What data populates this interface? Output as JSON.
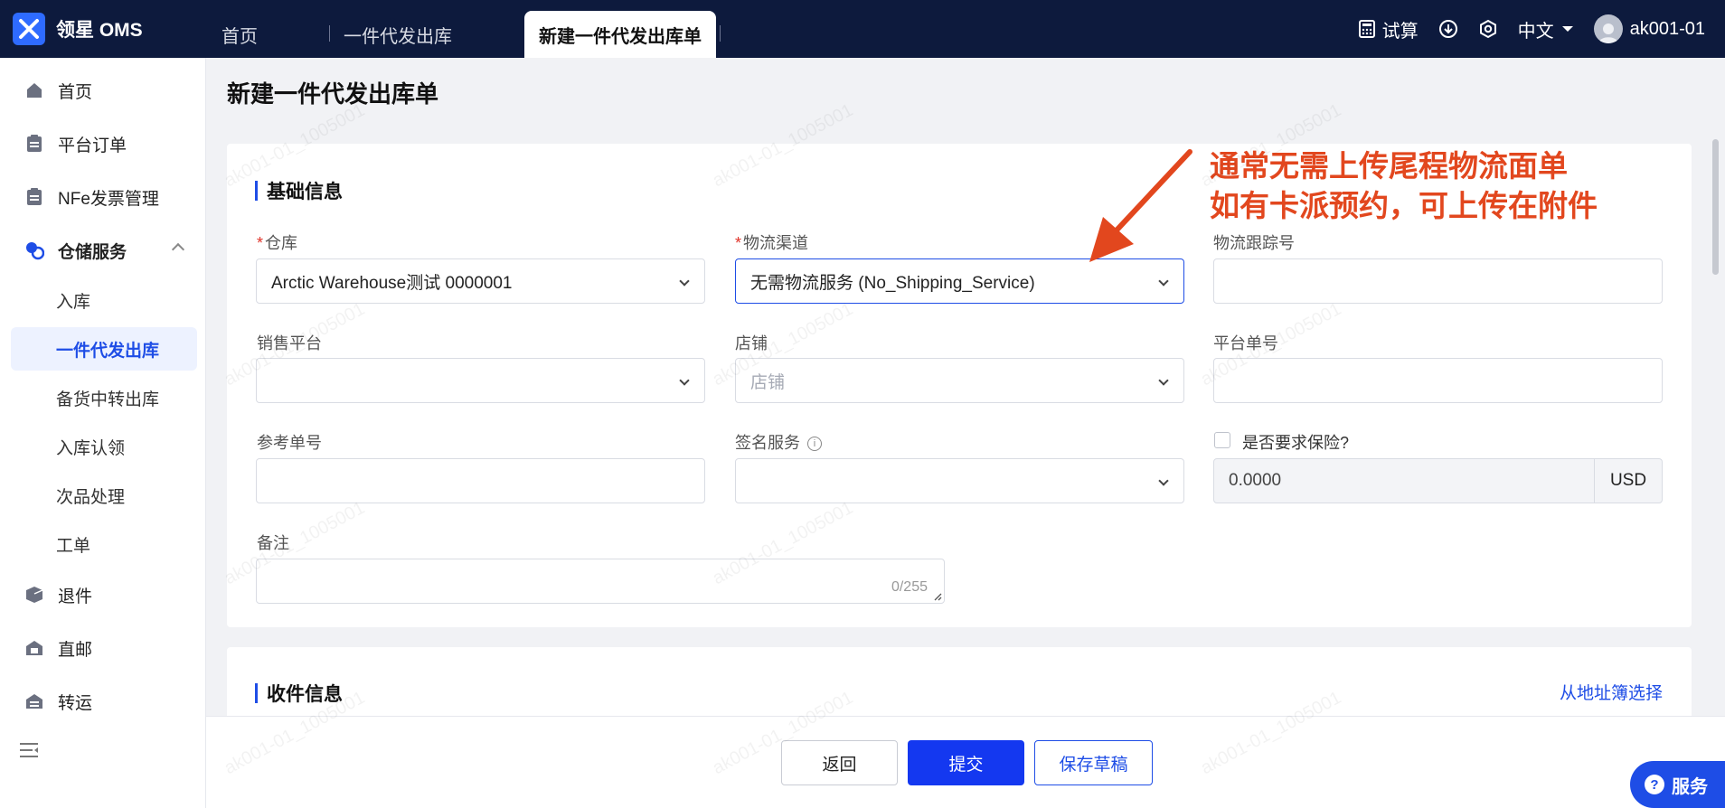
{
  "topbar": {
    "brand": "领星 OMS",
    "tabs": [
      "首页",
      "一件代发出库",
      "新建一件代发出库单"
    ],
    "trial": "试算",
    "language": "中文",
    "user": "ak001-01"
  },
  "sidebar": {
    "items": [
      {
        "label": "首页",
        "icon": "home-icon"
      },
      {
        "label": "平台订单",
        "icon": "clipboard-icon"
      },
      {
        "label": "NFe发票管理",
        "icon": "clipboard-icon"
      },
      {
        "label": "仓储服务",
        "icon": "warehouse-icon"
      },
      {
        "label": "退件",
        "icon": "box-return-icon"
      },
      {
        "label": "直邮",
        "icon": "house-mail-icon"
      },
      {
        "label": "转运",
        "icon": "transfer-icon"
      }
    ],
    "sub_items": [
      "入库",
      "一件代发出库",
      "备货中转出库",
      "入库认领",
      "次品处理",
      "工单"
    ]
  },
  "page": {
    "title": "新建一件代发出库单"
  },
  "basic": {
    "title": "基础信息",
    "warehouse_label": "仓库",
    "warehouse_value": "Arctic Warehouse测试 0000001",
    "channel_label": "物流渠道",
    "channel_value": "无需物流服务 (No_Shipping_Service)",
    "tracking_label": "物流跟踪号",
    "platform_label": "销售平台",
    "store_label": "店铺",
    "store_placeholder": "店铺",
    "platform_no_label": "平台单号",
    "ref_label": "参考单号",
    "sign_label": "签名服务",
    "insurance_label": "是否要求保险?",
    "insurance_value": "0.0000",
    "currency": "USD",
    "remark_label": "备注",
    "remark_counter": "0/255"
  },
  "annotation": {
    "line1": "通常无需上传尾程物流面单",
    "line2": "如有卡派预约，可上传在附件"
  },
  "receiver": {
    "title": "收件信息",
    "address_book_link": "从地址簿选择"
  },
  "footer": {
    "back": "返回",
    "submit": "提交",
    "draft": "保存草稿"
  },
  "service_button": "服务",
  "watermark_text": "ak001-01_1005001",
  "colors": {
    "topbar": "#0d1a3d",
    "accent": "#1e4de6",
    "annotation": "#e2471e"
  }
}
